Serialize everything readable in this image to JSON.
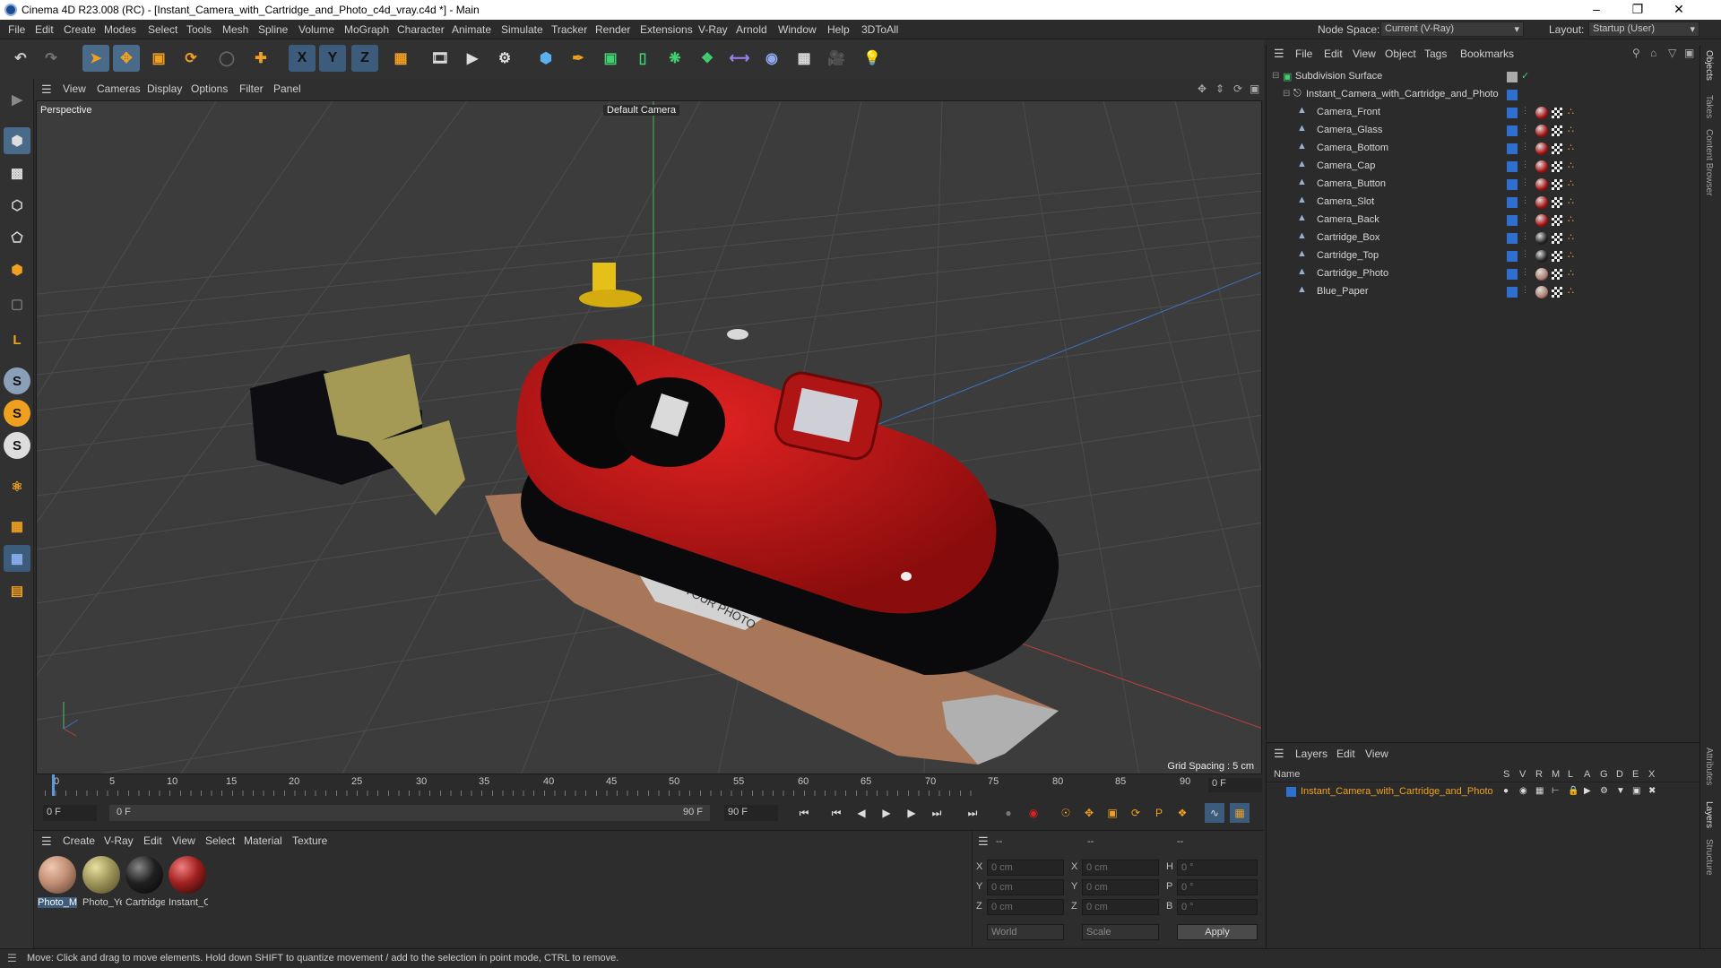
{
  "window": {
    "title": "Cinema 4D R23.008 (RC) - [Instant_Camera_with_Cartridge_and_Photo_c4d_vray.c4d *] - Main"
  },
  "menu": [
    "File",
    "Edit",
    "Create",
    "Modes",
    "Select",
    "Tools",
    "Mesh",
    "Spline",
    "Volume",
    "MoGraph",
    "Character",
    "Animate",
    "Simulate",
    "Tracker",
    "Render",
    "Extensions",
    "V-Ray",
    "Arnold",
    "Window",
    "Help",
    "3DToAll"
  ],
  "nodespace": {
    "label": "Node Space:",
    "value": "Current (V-Ray)"
  },
  "layout": {
    "label": "Layout:",
    "value": "Startup (User)"
  },
  "viewport_menu": [
    "View",
    "Cameras",
    "Display",
    "Options",
    "Filter",
    "Panel"
  ],
  "viewport": {
    "name": "Perspective",
    "camera": "Default Camera",
    "grid_spacing": "Grid Spacing : 5 cm",
    "photo_text": "YOUR PHOTO"
  },
  "timeline": {
    "ticks": [
      "0",
      "5",
      "10",
      "15",
      "20",
      "25",
      "30",
      "35",
      "40",
      "45",
      "50",
      "55",
      "60",
      "65",
      "70",
      "75",
      "80",
      "85",
      "90"
    ],
    "current_frame": "0 F"
  },
  "playback": {
    "start": "0 F",
    "range_start": "0 F",
    "range_end": "90 F",
    "end": "90 F"
  },
  "material_menu": [
    "Create",
    "V-Ray",
    "Edit",
    "View",
    "Select",
    "Material",
    "Texture"
  ],
  "materials": [
    {
      "name": "Photo_M",
      "color": "#c08e74"
    },
    {
      "name": "Photo_Ye",
      "color": "#9e955a"
    },
    {
      "name": "Cartridge",
      "color": "#202020"
    },
    {
      "name": "Instant_C",
      "color": "#a12020"
    }
  ],
  "coords": {
    "header": [
      "--",
      "--",
      "--"
    ],
    "rows": [
      {
        "a": "X",
        "av": "0 cm",
        "b": "X",
        "bv": "0 cm",
        "c": "H",
        "cv": "0 °"
      },
      {
        "a": "Y",
        "av": "0 cm",
        "b": "Y",
        "bv": "0 cm",
        "c": "P",
        "cv": "0 °"
      },
      {
        "a": "Z",
        "av": "0 cm",
        "b": "Z",
        "bv": "0 cm",
        "c": "B",
        "cv": "0 °"
      }
    ],
    "world": "World",
    "scale": "Scale",
    "apply": "Apply"
  },
  "objects_menu": [
    "File",
    "Edit",
    "View",
    "Object",
    "Tags",
    "Bookmarks"
  ],
  "objects": {
    "root": "Subdivision Surface",
    "group": "Instant_Camera_with_Cartridge_and_Photo",
    "children": [
      "Camera_Front",
      "Camera_Glass",
      "Camera_Bottom",
      "Camera_Cap",
      "Camera_Button",
      "Camera_Slot",
      "Camera_Back",
      "Cartridge_Box",
      "Cartridge_Top",
      "Cartridge_Photo",
      "Blue_Paper"
    ]
  },
  "layers_menu": [
    "Layers",
    "Edit",
    "View"
  ],
  "layers": {
    "name_header": "Name",
    "flags": [
      "S",
      "V",
      "R",
      "M",
      "L",
      "A",
      "G",
      "D",
      "E",
      "X"
    ],
    "items": [
      "Instant_Camera_with_Cartridge_and_Photo"
    ]
  },
  "right_tabs": [
    "Objects",
    "Takes",
    "Content Browser",
    "Attributes",
    "Layers",
    "Structure"
  ],
  "status": "Move: Click and drag to move elements. Hold down SHIFT to quantize movement / add to the selection in point mode, CTRL to remove."
}
